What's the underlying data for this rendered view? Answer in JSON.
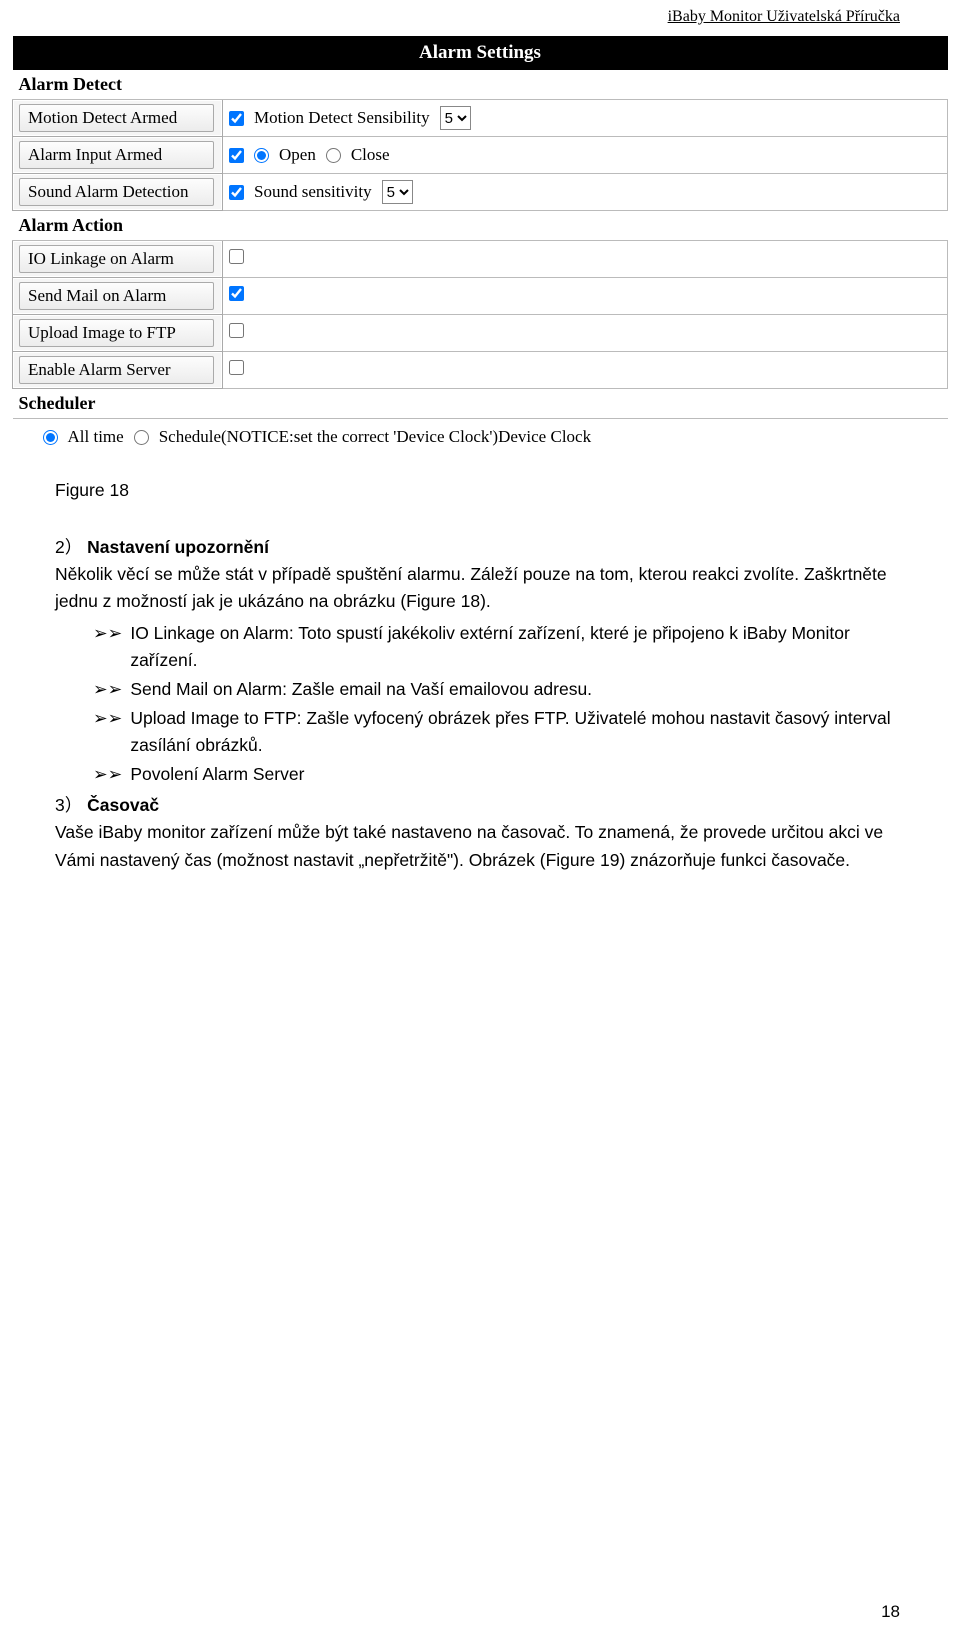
{
  "header": {
    "title": "iBaby Monitor Uživatelská Příručka"
  },
  "settings": {
    "title": "Alarm Settings",
    "section_detect": "Alarm Detect",
    "row_motion": {
      "label": "Motion Detect Armed",
      "sens": "Motion Detect Sensibility",
      "val": "5"
    },
    "row_alarm_input": {
      "label": "Alarm Input Armed",
      "open": "Open",
      "close": "Close"
    },
    "row_sound": {
      "label": "Sound Alarm Detection",
      "sens": "Sound sensitivity",
      "val": "5"
    },
    "section_action": "Alarm Action",
    "row_io": {
      "label": "IO Linkage on Alarm"
    },
    "row_mail": {
      "label": "Send Mail on Alarm"
    },
    "row_ftp": {
      "label": "Upload Image to FTP"
    },
    "row_server": {
      "label": "Enable Alarm Server"
    },
    "section_sched": "Scheduler",
    "sched": {
      "all": "All time",
      "sch": "Schedule(NOTICE:set the correct 'Device Clock')Device Clock"
    }
  },
  "body": {
    "fig18": "Figure 18",
    "h2_num": "2）",
    "h2": "Nastavení upozornění",
    "p1": "Několik věcí se může stát v případě spuštění alarmu. Záleží pouze na tom, kterou reakci zvolíte. Zaškrtněte jednu z možností jak je ukázáno na obrázku (Figure 18).",
    "b1": "IO Linkage on Alarm: Toto spustí jakékoliv extérní zařízení, které je připojeno k iBaby Monitor zařízení.",
    "b2": "Send Mail on Alarm: Zašle email na Vaší emailovou adresu.",
    "b3": "Upload Image to FTP: Zašle vyfocený obrázek přes FTP. Uživatelé mohou nastavit časový interval zasílání obrázků.",
    "b4": "Povolení Alarm Server",
    "h3_num": "3）",
    "h3": "Časovač",
    "p2": "Vaše iBaby monitor zařízení může být také nastaveno na časovač. To znamená, že provede určitou akci ve Vámi nastavený čas (možnost nastavit „nepřetržitě\"). Obrázek (Figure 19) znázorňuje funkci časovače."
  },
  "page": {
    "num": "18"
  }
}
